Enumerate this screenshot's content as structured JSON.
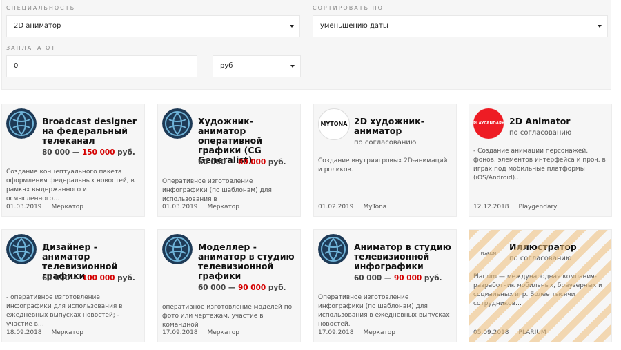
{
  "filters": {
    "specialty_label": "Специальность",
    "specialty_value": "2D аниматор",
    "sort_label": "Сортировать по",
    "sort_value": "уменьшению даты",
    "pay_label": "Заплата от",
    "pay_value": "0",
    "currency_value": "руб"
  },
  "colors": {
    "accent_red": "#d40000",
    "card_bg": "#f6f6f6",
    "merkator_logo": "#1e3a56"
  },
  "cards": [
    {
      "title": "Broadcast designer на федеральный телеканал",
      "salary_from": "80 000",
      "dash": "—",
      "salary_to": "150 000",
      "currency": "руб.",
      "desc": "Создание концептуального пакета оформления федеральных новостей, в рамках выдержанного и осмысленного…",
      "date": "01.03.2019",
      "company": "Меркатор",
      "logo": "merkator-logo"
    },
    {
      "title": "Художник-аниматор оперативной графики (CG Generalist)",
      "salary_from": "60 000",
      "dash": "—",
      "salary_to": "80 000",
      "currency": "руб.",
      "desc": "Оперативное изготовление инфографики (по шаблонам) для использования в",
      "date": "01.03.2019",
      "company": "Меркатор",
      "logo": "merkator-logo"
    },
    {
      "title": "2D художник-аниматор",
      "negotiable": "по согласованию",
      "desc": "Создание внутриигровых 2D-анимаций и роликов.",
      "date": "01.02.2019",
      "company": "MyTona",
      "logo": "mytona-logo",
      "logo_text": "MYTONA"
    },
    {
      "title": "2D Animator",
      "negotiable": "по согласованию",
      "desc": "- Создание анимации персонажей, фонов, элементов интерфейса и проч. в играх под мобильные платформы (iOS/Android)…",
      "date": "12.12.2018",
      "company": "Playgendary",
      "logo": "playgendary-logo",
      "logo_text": "PLAYGENDARY"
    },
    {
      "title": "Дизайнер - аниматор телевизионной графики",
      "salary_from": "60 000",
      "dash": "—",
      "salary_to": "100 000",
      "currency": "руб.",
      "desc": "- оперативное изготовление инфографики для использования в ежедневных выпусках новостей; - участие в…",
      "date": "18.09.2018",
      "company": "Меркатор",
      "logo": "merkator-logo"
    },
    {
      "title": "Моделлер - аниматор в студию телевизионной графики",
      "salary_from": "60 000",
      "dash": "—",
      "salary_to": "90 000",
      "currency": "руб.",
      "desc": "оперативное изготовление моделей по фото или чертежам, участие в командной",
      "date": "17.09.2018",
      "company": "Меркатор",
      "logo": "merkator-logo"
    },
    {
      "title": "Аниматор в студию телевизионной инфографики",
      "salary_from": "60 000",
      "dash": "—",
      "salary_to": "90 000",
      "currency": "руб.",
      "desc": "Оперативное изготовление инфографики (по шаблонам) для использования в ежедневных выпусках новостей.",
      "date": "17.09.2018",
      "company": "Меркатор",
      "logo": "merkator-logo"
    },
    {
      "title": "Иллюстратор",
      "negotiable": "по согласованию",
      "desc": "Plarium — международная компания-разработчик мобильных, браузерных и социальных игр. Более тысячи сотрудников…",
      "date": "05.09.2018",
      "company": "PLARIUM",
      "logo": "plarium-logo",
      "logo_text": "PLARIUM"
    }
  ]
}
